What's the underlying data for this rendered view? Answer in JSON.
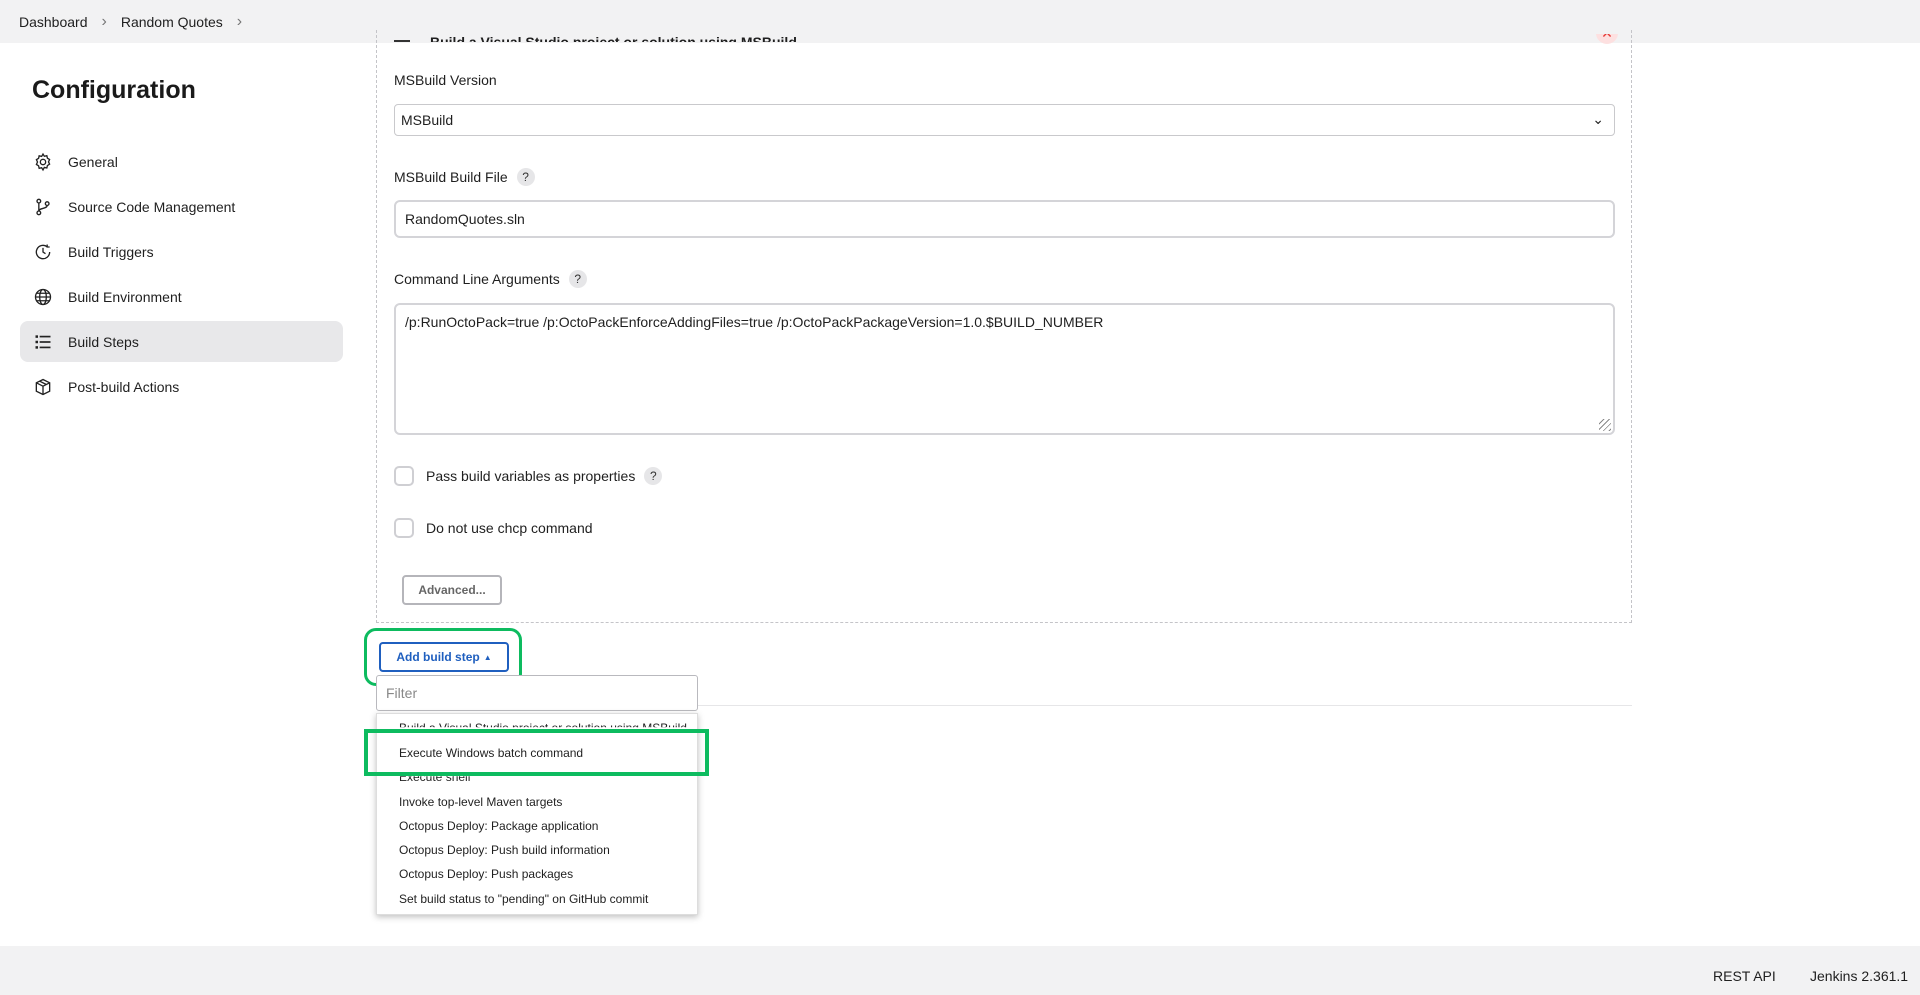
{
  "breadcrumb": {
    "items": [
      "Dashboard",
      "Random Quotes"
    ]
  },
  "sidebar": {
    "title": "Configuration",
    "items": [
      {
        "label": "General",
        "icon": "gear-icon"
      },
      {
        "label": "Source Code Management",
        "icon": "branch-icon"
      },
      {
        "label": "Build Triggers",
        "icon": "clock-icon"
      },
      {
        "label": "Build Environment",
        "icon": "globe-icon"
      },
      {
        "label": "Build Steps",
        "icon": "list-icon",
        "active": true
      },
      {
        "label": "Post-build Actions",
        "icon": "package-icon"
      }
    ]
  },
  "step": {
    "title": "Build a Visual Studio project or solution using MSBuild",
    "msbuild_version_label": "MSBuild Version",
    "msbuild_version_value": "MSBuild",
    "build_file_label": "MSBuild Build File",
    "build_file_value": "RandomQuotes.sln",
    "cmd_args_label": "Command Line Arguments",
    "cmd_args_value": "/p:RunOctoPack=true /p:OctoPackEnforceAddingFiles=true /p:OctoPackPackageVersion=1.0.$BUILD_NUMBER",
    "pass_vars_label": "Pass build variables as properties",
    "no_chcp_label": "Do not use chcp command",
    "advanced_label": "Advanced...",
    "help_glyph": "?",
    "close_glyph": "✕"
  },
  "add_step": {
    "button_label": "Add build step",
    "filter_placeholder": "Filter",
    "menu": [
      "Build a Visual Studio project or solution using MSBuild",
      "Execute Windows batch command",
      "Execute shell",
      "Invoke top-level Maven targets",
      "Octopus Deploy: Package application",
      "Octopus Deploy: Push build information",
      "Octopus Deploy: Push packages",
      "Set build status to \"pending\" on GitHub commit"
    ],
    "highlight_color": "#0dbb5f"
  },
  "footer": {
    "rest_api": "REST API",
    "version": "Jenkins 2.361.1"
  }
}
